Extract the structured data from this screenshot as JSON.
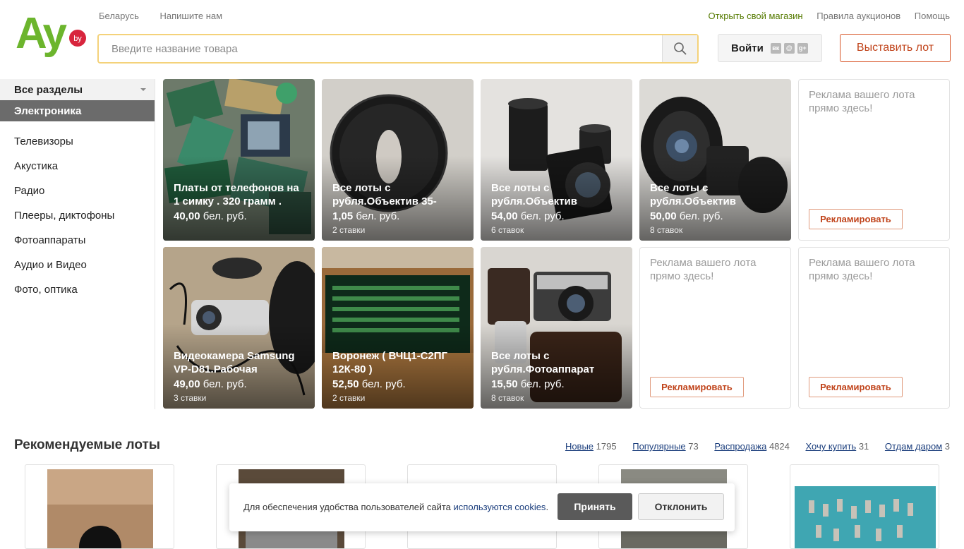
{
  "header": {
    "logo_text": "Ay",
    "logo_badge": "by",
    "top_left_links": [
      "Беларусь",
      "Напишите нам"
    ],
    "top_right_links": [
      "Открыть свой магазин",
      "Правила аукционов",
      "Помощь"
    ],
    "search_placeholder": "Введите название товара",
    "login_label": "Войти",
    "social_icons": [
      "vk-icon",
      "mail-icon",
      "google-plus-icon"
    ],
    "sell_button": "Выставить лот"
  },
  "sidebar": {
    "all_sections": "Все разделы",
    "active_category": "Электроника",
    "items": [
      "Телевизоры",
      "Акустика",
      "Радио",
      "Плееры, диктофоны",
      "Фотоаппараты",
      "Аудио и Видео",
      "Фото, оптика"
    ]
  },
  "lots": [
    {
      "title": "Платы от телефонов на 1 симку . 320 грамм .",
      "price": "40,00",
      "currency": "бел. руб.",
      "bids": ""
    },
    {
      "title": "Все лоты с рубля.Объектив 35-",
      "price": "1,05",
      "currency": "бел. руб.",
      "bids": "2 ставки"
    },
    {
      "title": "Все лоты с рубля.Объектив",
      "price": "54,00",
      "currency": "бел. руб.",
      "bids": "6 ставок"
    },
    {
      "title": "Все лоты с рубля.Объектив",
      "price": "50,00",
      "currency": "бел. руб.",
      "bids": "8 ставок"
    },
    {
      "title": "Видеокамера Samsung VP-D81.Рабочая",
      "price": "49,00",
      "currency": "бел. руб.",
      "bids": "3 ставки"
    },
    {
      "title": "Воронеж ( ВЧЦ1-С2ПГ 12К-80 )",
      "price": "52,50",
      "currency": "бел. руб.",
      "bids": "2 ставки"
    },
    {
      "title": "Все лоты с рубля.Фотоаппарат",
      "price": "15,50",
      "currency": "бел. руб.",
      "bids": "8 ставок"
    }
  ],
  "ads": {
    "text": "Реклама вашего лота прямо здесь!",
    "button": "Рекламировать"
  },
  "recommended": {
    "title": "Рекомендуемые лоты",
    "tabs": [
      {
        "label": "Новые",
        "count": "1795"
      },
      {
        "label": "Популярные",
        "count": "73"
      },
      {
        "label": "Распродажа",
        "count": "4824"
      },
      {
        "label": "Хочу купить",
        "count": "31"
      },
      {
        "label": "Отдам даром",
        "count": "3"
      }
    ]
  },
  "cookie": {
    "text": "Для обеспечения удобства пользователей сайта",
    "link": "используются cookies",
    "period": ".",
    "accept": "Принять",
    "decline": "Отклонить"
  },
  "colors": {
    "brand_green": "#6cb52d",
    "brand_red": "#d8253d",
    "accent_orange": "#c0431a"
  }
}
